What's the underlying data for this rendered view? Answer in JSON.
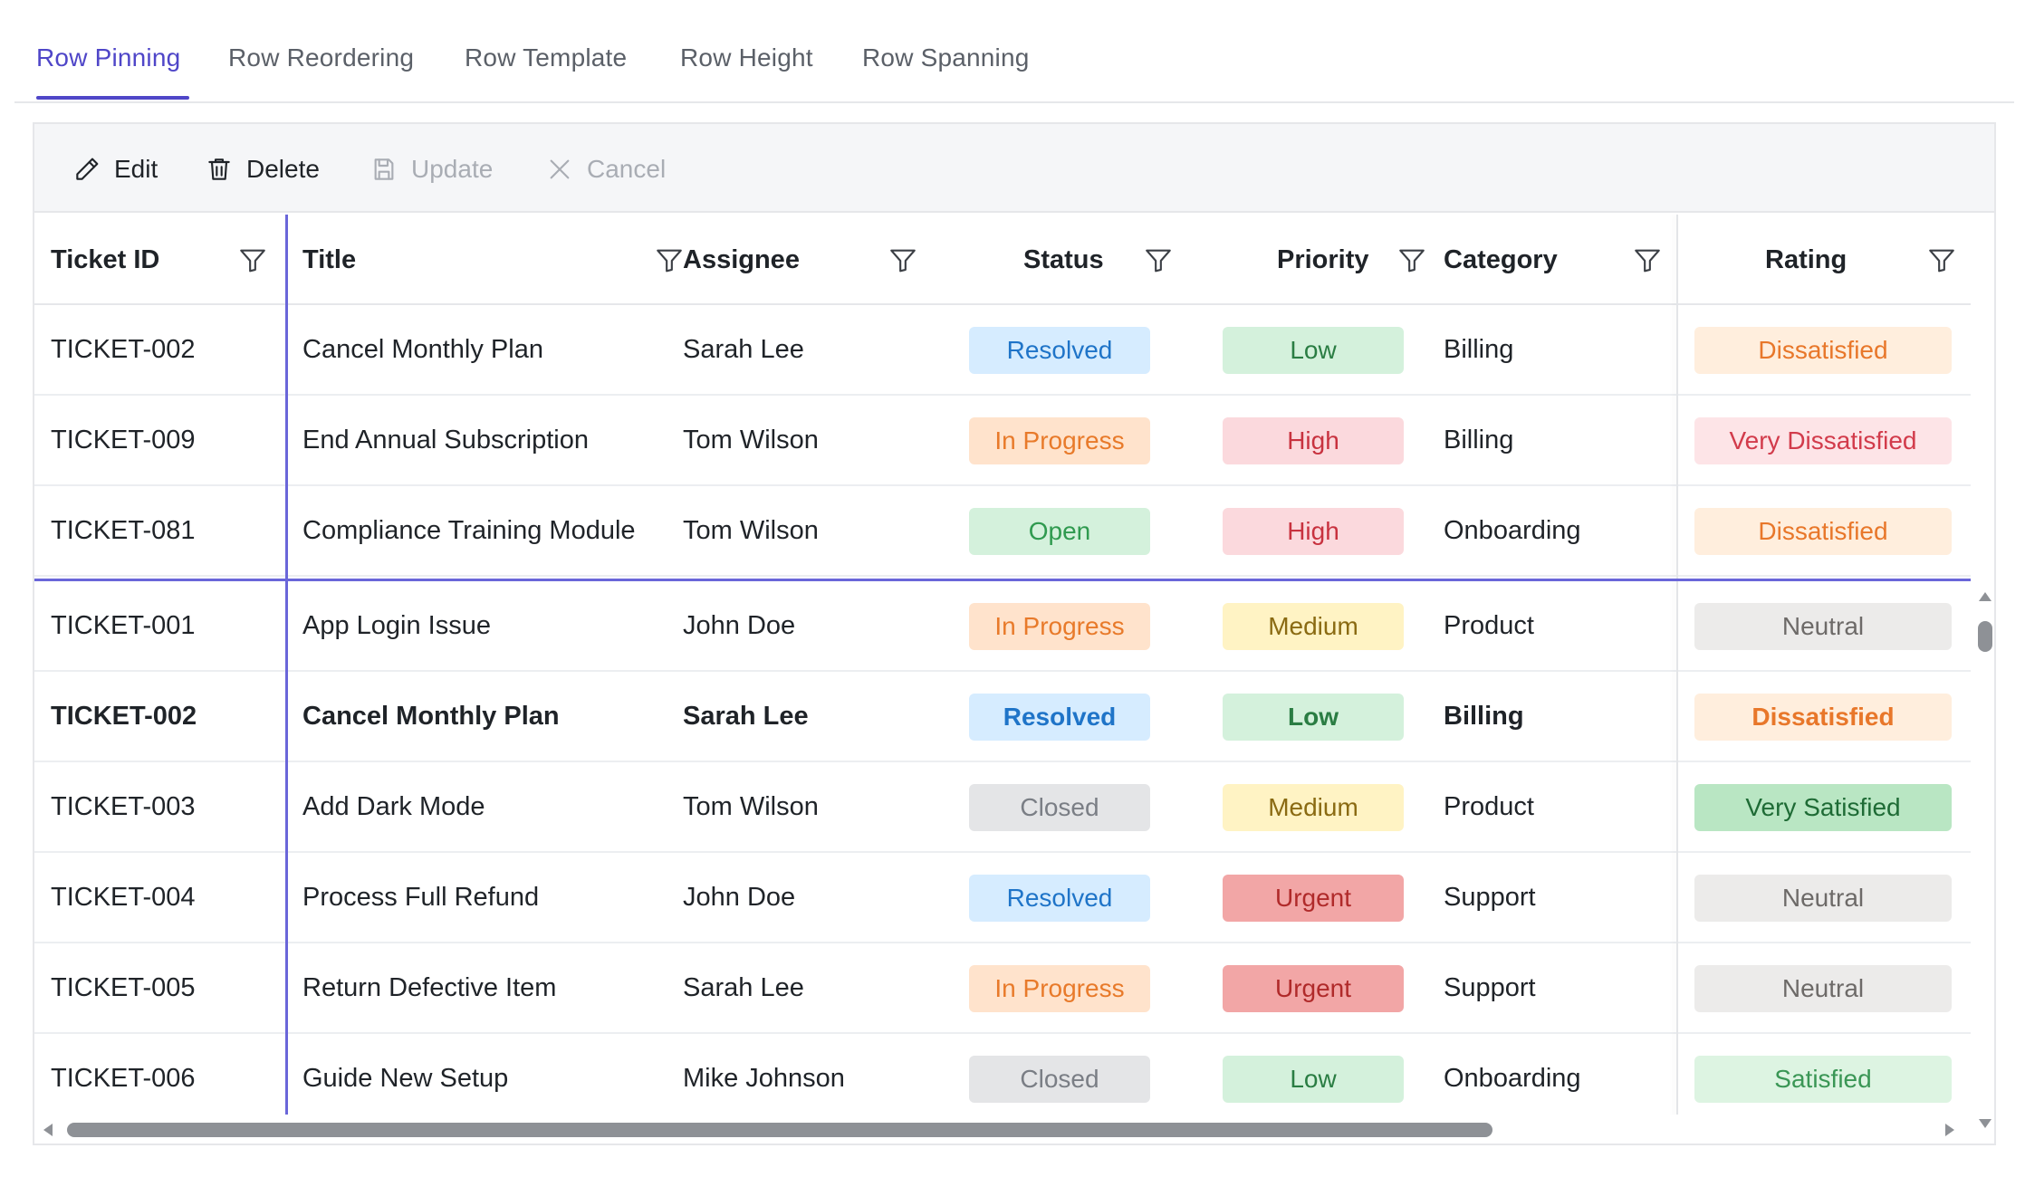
{
  "tabs": [
    {
      "label": "Row Pinning",
      "active": true
    },
    {
      "label": "Row Reordering",
      "active": false
    },
    {
      "label": "Row Template",
      "active": false
    },
    {
      "label": "Row Height",
      "active": false
    },
    {
      "label": "Row Spanning",
      "active": false
    }
  ],
  "toolbar": {
    "edit": "Edit",
    "delete": "Delete",
    "update": "Update",
    "cancel": "Cancel"
  },
  "columns": {
    "ticket_id": "Ticket ID",
    "title": "Title",
    "assignee": "Assignee",
    "status": "Status",
    "priority": "Priority",
    "category": "Category",
    "rating": "Rating"
  },
  "colors": {
    "accent": "#4f46c8",
    "status": {
      "Resolved": {
        "bg": "#d6ecff",
        "fg": "#1f74c8"
      },
      "In Progress": {
        "bg": "#ffe3cc",
        "fg": "#e87a2a"
      },
      "Open": {
        "bg": "#d4f1dc",
        "fg": "#2f9a4f"
      },
      "Closed": {
        "bg": "#e4e5e7",
        "fg": "#7a7e85"
      }
    },
    "priority": {
      "Low": {
        "bg": "#d4f1dc",
        "fg": "#2a7d43"
      },
      "High": {
        "bg": "#fbd9dd",
        "fg": "#c8323f"
      },
      "Medium": {
        "bg": "#fff3c4",
        "fg": "#8a6a12"
      },
      "Urgent": {
        "bg": "#f2a6a6",
        "fg": "#b02a2a"
      }
    },
    "rating": {
      "Dissatisfied": {
        "bg": "#ffeedd",
        "fg": "#e8772a"
      },
      "Very Dissatisfied": {
        "bg": "#fde4e7",
        "fg": "#d23b4b"
      },
      "Neutral": {
        "bg": "#ecebea",
        "fg": "#6d6a68"
      },
      "Very Satisfied": {
        "bg": "#b9e6c3",
        "fg": "#1e6b35"
      },
      "Satisfied": {
        "bg": "#ddf4e2",
        "fg": "#3a9655"
      }
    }
  },
  "pinned_rows": [
    {
      "id": "TICKET-002",
      "title": "Cancel Monthly Plan",
      "assignee": "Sarah Lee",
      "status": "Resolved",
      "priority": "Low",
      "category": "Billing",
      "rating": "Dissatisfied"
    },
    {
      "id": "TICKET-009",
      "title": "End Annual Subscription",
      "assignee": "Tom Wilson",
      "status": "In Progress",
      "priority": "High",
      "category": "Billing",
      "rating": "Very Dissatisfied"
    },
    {
      "id": "TICKET-081",
      "title": "Compliance Training Module",
      "assignee": "Tom Wilson",
      "status": "Open",
      "priority": "High",
      "category": "Onboarding",
      "rating": "Dissatisfied"
    }
  ],
  "rows": [
    {
      "id": "TICKET-001",
      "title": "App Login Issue",
      "assignee": "John Doe",
      "status": "In Progress",
      "priority": "Medium",
      "category": "Product",
      "rating": "Neutral",
      "bold": false
    },
    {
      "id": "TICKET-002",
      "title": "Cancel Monthly Plan",
      "assignee": "Sarah Lee",
      "status": "Resolved",
      "priority": "Low",
      "category": "Billing",
      "rating": "Dissatisfied",
      "bold": true
    },
    {
      "id": "TICKET-003",
      "title": "Add Dark Mode",
      "assignee": "Tom Wilson",
      "status": "Closed",
      "priority": "Medium",
      "category": "Product",
      "rating": "Very Satisfied",
      "bold": false
    },
    {
      "id": "TICKET-004",
      "title": "Process Full Refund",
      "assignee": "John Doe",
      "status": "Resolved",
      "priority": "Urgent",
      "category": "Support",
      "rating": "Neutral",
      "bold": false
    },
    {
      "id": "TICKET-005",
      "title": "Return Defective Item",
      "assignee": "Sarah Lee",
      "status": "In Progress",
      "priority": "Urgent",
      "category": "Support",
      "rating": "Neutral",
      "bold": false
    },
    {
      "id": "TICKET-006",
      "title": "Guide New Setup",
      "assignee": "Mike Johnson",
      "status": "Closed",
      "priority": "Low",
      "category": "Onboarding",
      "rating": "Satisfied",
      "bold": false
    }
  ]
}
